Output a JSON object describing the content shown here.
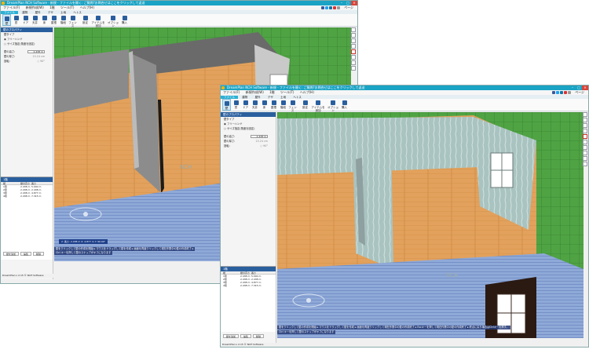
{
  "window_title": "DreamPlan NCH Software - 新規 - ファイルを開く: ご質問?お問合せはここをクリックして返送",
  "menu": [
    "ファイル(F)",
    "新規作成(W)",
    "1階",
    "ツール(T)",
    "ヘルプ(H)"
  ],
  "tabs": [
    "ファイル",
    "建物",
    "屋外",
    "デザ",
    "土地",
    "ヘトス"
  ],
  "ribbon": [
    "壁",
    "窓",
    "ドア",
    "天井",
    "床",
    "屋根",
    "階段",
    "フェンス",
    "設定",
    "アイテムを追加",
    "オプション",
    "購入"
  ],
  "panel": {
    "header": "壁のプロパティ",
    "mode_label": "壁タイプ",
    "opt1": "フリーハンド",
    "opt2": "サイズ指定(角度を固定)",
    "height_label": "壁の高さ:",
    "height_value": "2.438 m",
    "thickness_label": "壁の厚さ:",
    "thickness_value": "15.24 cm",
    "rotate_label": "回転:",
    "rotate_hint": "○ 90°"
  },
  "wall_list": {
    "header": "1階",
    "columns": [
      "壁",
      "壁の高さ",
      "長さ"
    ],
    "rows": [
      [
        "1階",
        "2.438 m",
        "5.000 m"
      ],
      [
        "2階",
        "2.438 m",
        "2.438 m"
      ],
      [
        "3階",
        "2.438 m",
        "4.877 m"
      ],
      [
        "4階",
        "2.438 m",
        "7.315 m"
      ]
    ]
  },
  "bottom_buttons": [
    "壁を追加",
    "編集",
    "削除"
  ],
  "status_left": "DreamPlan v 2.15 © NCH Software",
  "status_right": "DreamPlan v 2.15 © NCH Software",
  "tip_front": "壁をクリックして壁の作成を開始 ▸ マウスをドラッグして壁を作成 ▸ 画面を再度クリックして現在作業中の壁の作成終了 ▸ Escキーを押して現在作業中の壁の作成終了 ▸ 終点に戻り場合はCtrlキーを押す。",
  "tip_front2": "Ctrl キーを押して壁のスナップがオフになります",
  "tip_back": "壁をクリックして壁の作成を開始 ▸ マウスをドラッグして壁を作成 ▸ 画面を再度クリックして現在作業中の壁の作成終了 ▸",
  "tip_back2": "Ctrl キーを押して壁のスナップがオフになります",
  "dim_box": "2: 長さ: 2.438 m   X: 4.877 m  Y: 90.00°",
  "nch_watermark": "NCH",
  "page_label": "ページ",
  "colors": {
    "titlebar": "#1aa3c4",
    "accent": "#2a5f9e",
    "grass": "#4fa343",
    "floor": "#e2a15c",
    "wall_siding": "#8fa9d8"
  }
}
